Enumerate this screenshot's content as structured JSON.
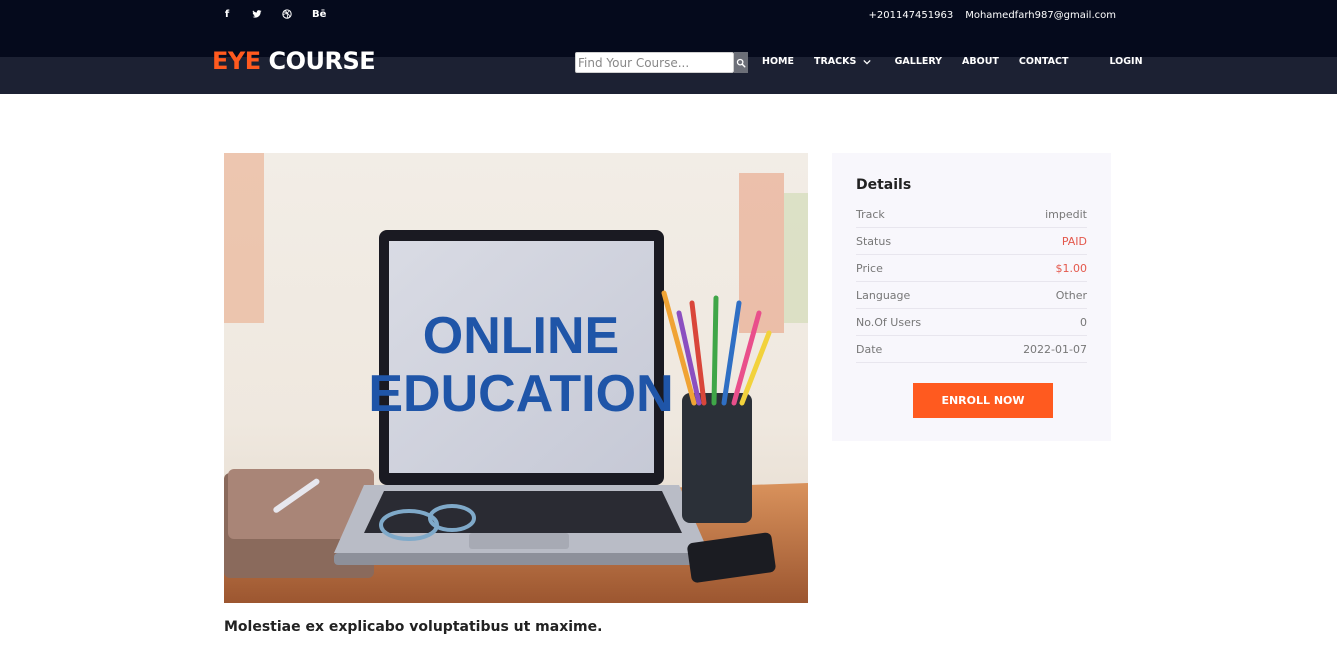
{
  "topbar": {
    "social": [
      {
        "icon": "facebook-icon",
        "glyph": "f"
      },
      {
        "icon": "twitter-icon",
        "glyph": "🐦"
      },
      {
        "icon": "dribbble-icon",
        "glyph": "⊛"
      },
      {
        "icon": "behance-icon",
        "glyph": "Bē"
      }
    ],
    "phone": "+201147451963",
    "email": "Mohamedfarh987@gmail.com"
  },
  "logo": {
    "part1": "EYE",
    "part2": "COURSE"
  },
  "search": {
    "placeholder": "Find Your Course..."
  },
  "nav": {
    "home": "HOME",
    "tracks": "TRACKS",
    "gallery": "GALLERY",
    "about": "ABOUT",
    "contact": "CONTACT",
    "login": "LOGIN"
  },
  "image": {
    "line1": "ONLINE",
    "line2": "EDUCATION"
  },
  "course": {
    "description": "Molestiae ex explicabo voluptatibus ut maxime."
  },
  "details": {
    "title": "Details",
    "rows": [
      {
        "label": "Track",
        "value": "impedit"
      },
      {
        "label": "Status",
        "value": "PAID"
      },
      {
        "label": "Price",
        "value": "$1.00"
      },
      {
        "label": "Language",
        "value": "Other"
      },
      {
        "label": "No.Of Users",
        "value": "0"
      },
      {
        "label": "Date",
        "value": "2022-01-07"
      }
    ],
    "enroll_label": "ENROLL NOW"
  },
  "colors": {
    "accent": "#ff5a1f",
    "header_top": "#050a1c",
    "header_nav": "#1c2133",
    "value_red": "#e4584c"
  }
}
